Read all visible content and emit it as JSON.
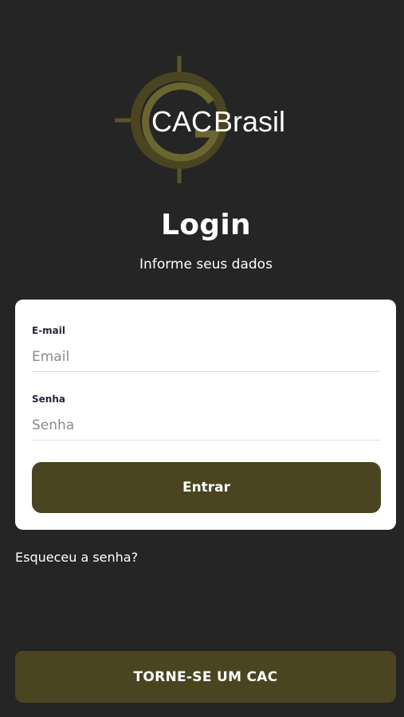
{
  "logo": {
    "text_cac": "CAC",
    "text_brasil": "Brasil",
    "ring_color": "#5a5528",
    "accent_color": "#6b6530"
  },
  "header": {
    "title": "Login",
    "subtitle": "Informe seus dados"
  },
  "form": {
    "email_label": "E-mail",
    "email_placeholder": "Email",
    "email_value": "",
    "password_label": "Senha",
    "password_placeholder": "Senha",
    "password_value": "",
    "submit_label": "Entrar"
  },
  "links": {
    "forgot_password": "Esqueceu a senha?"
  },
  "footer": {
    "signup_label": "TORNE-SE UM CAC"
  },
  "colors": {
    "background": "#252525",
    "card": "#ffffff",
    "button": "#4a4520"
  }
}
